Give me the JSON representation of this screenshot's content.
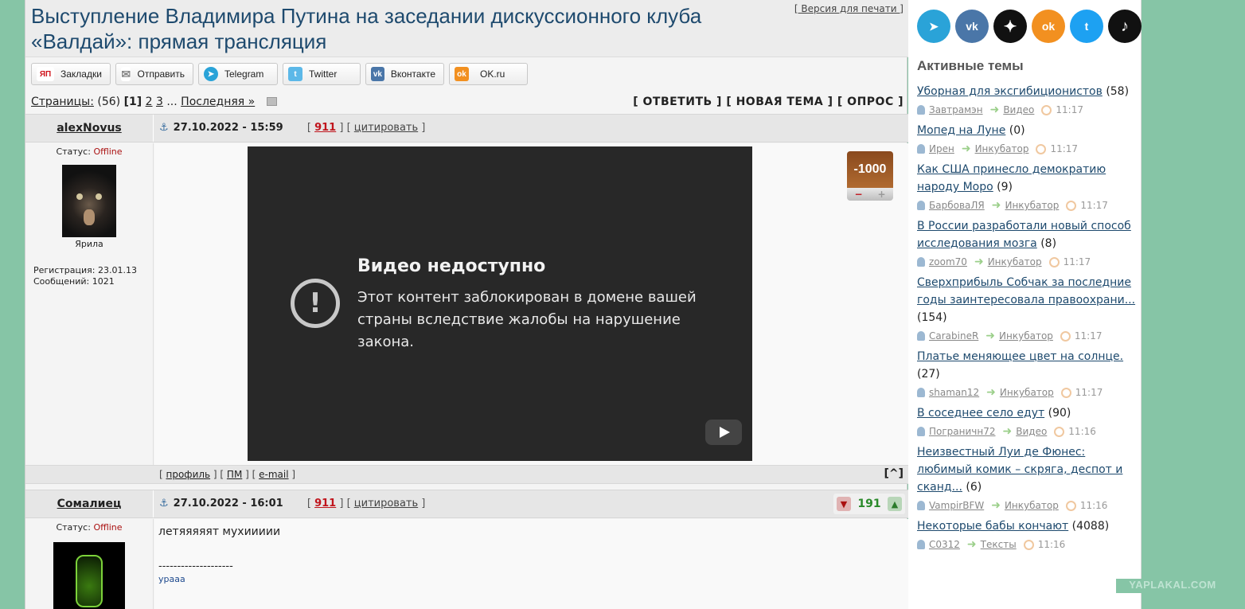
{
  "thread": {
    "title": "Выступление Владимира Путина на заседании дискуссионного клуба «Валдай»: прямая трансляция",
    "print_link": "[ Версия для печати ]"
  },
  "share": [
    {
      "label": "Закладки",
      "icon": "yandex-bookmarks-icon",
      "icon_text": "ЯП",
      "color": "#d0141c"
    },
    {
      "label": "Отправить",
      "icon": "mail-icon",
      "icon_text": "✉",
      "color": "#888888"
    },
    {
      "label": "Telegram",
      "icon": "telegram-icon",
      "icon_text": "➤",
      "color": "#2aa3d8"
    },
    {
      "label": "Twitter",
      "icon": "twitter-icon",
      "icon_text": "t",
      "color": "#5cb8e8"
    },
    {
      "label": "Вконтакте",
      "icon": "vk-icon",
      "icon_text": "vk",
      "color": "#4a76a8"
    },
    {
      "label": "OK.ru",
      "icon": "ok-icon",
      "icon_text": "ok",
      "color": "#f29020"
    }
  ],
  "pager": {
    "label": "Страницы:",
    "count": "(56)",
    "current": "[1]",
    "p2": "2",
    "p3": "3",
    "ellipsis": "...",
    "last": "Последняя »"
  },
  "actions": {
    "reply": "[ ОТВЕТИТЬ ]",
    "new_topic": "[ НОВАЯ ТЕМА ]",
    "poll": "[ ОПРОС ]"
  },
  "post1": {
    "author": "alexNovus",
    "date": "27.10.2022 - 15:59",
    "number": "911",
    "quote": "цитировать",
    "status_label": "Статус:",
    "status": "Offline",
    "avatar_caption": "Ярила",
    "registration": "Регистрация: 23.01.13",
    "messages": "Сообщений: 1021",
    "video_title": "Видео недоступно",
    "video_message": "Этот контент заблокирован в домене вашей страны вследствие жалобы на нарушение закона.",
    "rating": "-1000",
    "foot_profile": "профиль",
    "foot_pm": "ПМ",
    "foot_email": "e-mail",
    "to_top": "[^]"
  },
  "post2": {
    "author": "Сомалиец",
    "date": "27.10.2022 - 16:01",
    "number": "911",
    "quote": "цитировать",
    "status_label": "Статус:",
    "status": "Offline",
    "score": "191",
    "text": "летяяяяят мухиииии",
    "separator": "--------------------",
    "signature": "урааа"
  },
  "sidebar": {
    "social": [
      {
        "name": "telegram-icon",
        "glyph": "➤",
        "color": "#2aa3d8"
      },
      {
        "name": "vk-icon",
        "glyph": "vk",
        "color": "#4a76a8"
      },
      {
        "name": "zen-icon",
        "glyph": "✦",
        "color": "#111111"
      },
      {
        "name": "ok-icon",
        "glyph": "ok",
        "color": "#f29020"
      },
      {
        "name": "twitter-icon",
        "glyph": "t",
        "color": "#1da1f2"
      },
      {
        "name": "tiktok-icon",
        "glyph": "♪",
        "color": "#111111"
      }
    ],
    "active_title": "Активные темы",
    "topics": [
      {
        "title": "Уборная для эксгибиционистов",
        "count": "(58)",
        "user": "Завтрамэн",
        "section": "Видео",
        "time": "11:17"
      },
      {
        "title": "Мопед на Луне",
        "count": "(0)",
        "user": "Ирен",
        "section": "Инкубатор",
        "time": "11:17"
      },
      {
        "title": "Как США принесло демократию народу Моро",
        "count": "(9)",
        "user": "БарбоваЛЯ",
        "section": "Инкубатор",
        "time": "11:17"
      },
      {
        "title": "В России разработали новый способ исследования мозга",
        "count": "(8)",
        "user": "zoom70",
        "section": "Инкубатор",
        "time": "11:17"
      },
      {
        "title": "Сверхприбыль Собчак за последние годы заинтересовала правоохрани...",
        "count": "(154)",
        "user": "CarabineR",
        "section": "Инкубатор",
        "time": "11:17"
      },
      {
        "title": "Платье меняющее цвет на солнце.",
        "count": "(27)",
        "user": "shaman12",
        "section": "Инкубатор",
        "time": "11:17"
      },
      {
        "title": "В соседнее село едут",
        "count": "(90)",
        "user": "Пограничн72",
        "section": "Видео",
        "time": "11:16"
      },
      {
        "title": "Неизвестный Луи де Фюнес: любимый комик – скряга, деспот и сканд...",
        "count": "(6)",
        "user": "VampirBFW",
        "section": "Инкубатор",
        "time": "11:16"
      },
      {
        "title": "Некоторые бабы кончают",
        "count": "(4088)",
        "user": "C0312",
        "section": "Тексты",
        "time": "11:16"
      }
    ]
  },
  "watermark": "YAPLAKAL.COM"
}
